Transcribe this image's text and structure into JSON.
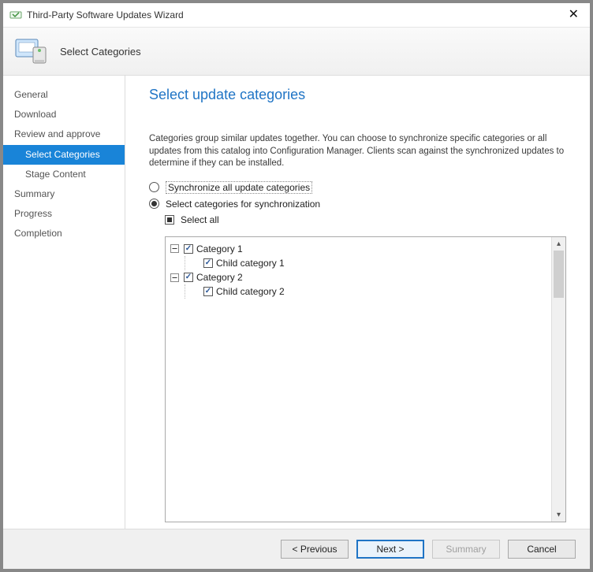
{
  "window": {
    "title": "Third-Party Software Updates Wizard",
    "close_symbol": "✕"
  },
  "header": {
    "subtitle": "Select Categories"
  },
  "sidebar": {
    "items": [
      {
        "label": "General",
        "sub": false,
        "selected": false
      },
      {
        "label": "Download",
        "sub": false,
        "selected": false
      },
      {
        "label": "Review and approve",
        "sub": false,
        "selected": false
      },
      {
        "label": "Select Categories",
        "sub": true,
        "selected": true
      },
      {
        "label": "Stage Content",
        "sub": true,
        "selected": false
      },
      {
        "label": "Summary",
        "sub": false,
        "selected": false
      },
      {
        "label": "Progress",
        "sub": false,
        "selected": false
      },
      {
        "label": "Completion",
        "sub": false,
        "selected": false
      }
    ]
  },
  "main": {
    "page_title": "Select update categories",
    "description": "Categories group similar updates together. You can choose to synchronize specific categories or all updates from this catalog into Configuration Manager. Clients scan against the synchronized updates to determine if they can be installed.",
    "radio_sync_all": {
      "label": "Synchronize all update categories",
      "selected": false
    },
    "radio_select_cat": {
      "label": "Select categories for synchronization",
      "selected": true
    },
    "select_all_label": "Select all",
    "tree": [
      {
        "label": "Category 1",
        "checked": true,
        "children": [
          {
            "label": "Child category 1",
            "checked": true
          }
        ]
      },
      {
        "label": "Category 2",
        "checked": true,
        "children": [
          {
            "label": "Child category 2",
            "checked": true
          }
        ]
      }
    ]
  },
  "footer": {
    "previous": "< Previous",
    "next": "Next >",
    "summary": "Summary",
    "cancel": "Cancel"
  }
}
